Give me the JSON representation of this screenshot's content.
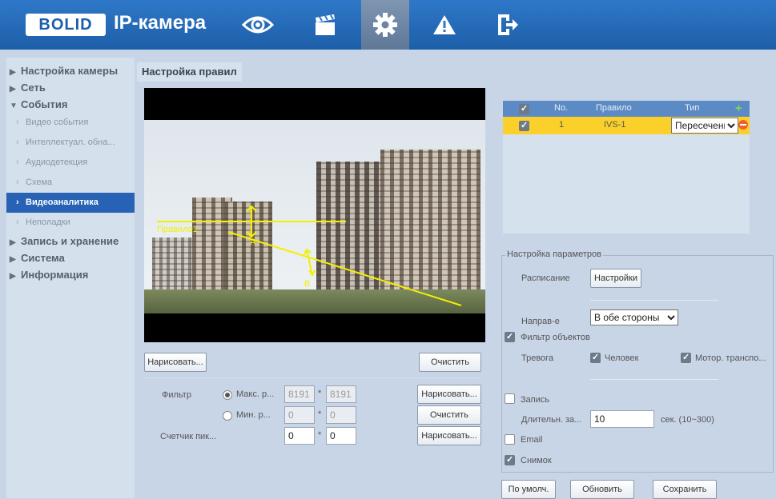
{
  "header": {
    "logo": "BOLID",
    "title": "IP-камера",
    "nav": [
      "eye-icon",
      "clapper-icon",
      "gear-icon",
      "warning-icon",
      "logout-icon"
    ],
    "active_nav": "gear-icon",
    "accent": "#1d5ea8"
  },
  "sidebar": {
    "items": [
      {
        "label": "Настройка камеры",
        "level": "main",
        "expanded": false
      },
      {
        "label": "Сеть",
        "level": "main",
        "expanded": false
      },
      {
        "label": "События",
        "level": "main",
        "expanded": true
      },
      {
        "label": "Видео события",
        "level": "sub"
      },
      {
        "label": "Интеллектуал. обна...",
        "level": "sub"
      },
      {
        "label": "Аудиодетекция",
        "level": "sub"
      },
      {
        "label": "Схема",
        "level": "sub"
      },
      {
        "label": "Видеоаналитика",
        "level": "sub",
        "active": true
      },
      {
        "label": "Неполадки",
        "level": "sub"
      },
      {
        "label": "Запись и хранение",
        "level": "main",
        "expanded": false
      },
      {
        "label": "Система",
        "level": "main",
        "expanded": false
      },
      {
        "label": "Информация",
        "level": "main",
        "expanded": false
      }
    ]
  },
  "page": {
    "tab": "Настройка правил"
  },
  "video": {
    "rule_label": "Правило1",
    "dir_a": "A",
    "dir_b": "B"
  },
  "draw": {
    "draw_label": "Нарисовать...",
    "clear_label": "Очистить"
  },
  "filter": {
    "label": "Фильтр",
    "max_label": "Макс. р...",
    "max_w": "8191",
    "max_h": "8191",
    "min_label": "Мин. р...",
    "min_w": "0",
    "min_h": "0",
    "sep": "*",
    "counter_label": "Счетчик пик...",
    "counter_w": "0",
    "counter_h": "0",
    "draw_label": "Нарисовать...",
    "clear_label": "Очистить",
    "draw2_label": "Нарисовать..."
  },
  "rules": {
    "headers": [
      "No.",
      "Правило",
      "Тип"
    ],
    "rows": [
      {
        "no": "1",
        "name": "IVS-1",
        "type": "Пересечение"
      }
    ],
    "row_color": "#fcd02a"
  },
  "params": {
    "title": "Настройка параметров",
    "schedule_label": "Расписание",
    "schedule_btn": "Настройки",
    "direction_label": "Направ-е",
    "direction_value": "В обе стороны",
    "object_filter_label": "Фильтр объектов",
    "alarm_label": "Тревога",
    "human_label": "Человек",
    "vehicle_label": "Мотор. транспо...",
    "record_label": "Запись",
    "duration_label": "Длительн. за...",
    "duration_value": "10",
    "duration_unit": "сек. (10~300)",
    "email_label": "Email",
    "snapshot_label": "Снимок"
  },
  "footer": {
    "default_label": "По умолч.",
    "refresh_label": "Обновить",
    "save_label": "Сохранить"
  }
}
